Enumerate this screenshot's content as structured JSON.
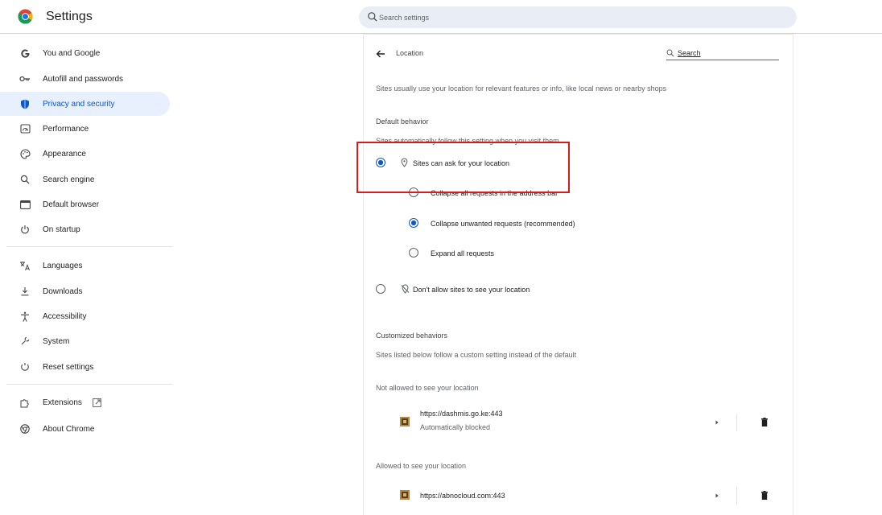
{
  "header": {
    "app_title": "Settings",
    "search_placeholder": "Search settings"
  },
  "sidebar": {
    "items": [
      {
        "label": "You and Google",
        "icon": "google-g-icon"
      },
      {
        "label": "Autofill and passwords",
        "icon": "key-icon"
      },
      {
        "label": "Privacy and security",
        "icon": "shield-icon",
        "active": true
      },
      {
        "label": "Performance",
        "icon": "speedometer-icon"
      },
      {
        "label": "Appearance",
        "icon": "palette-icon"
      },
      {
        "label": "Search engine",
        "icon": "search-icon"
      },
      {
        "label": "Default browser",
        "icon": "browser-window-icon"
      },
      {
        "label": "On startup",
        "icon": "power-icon"
      },
      {
        "label": "Languages",
        "icon": "translate-icon"
      },
      {
        "label": "Downloads",
        "icon": "download-icon"
      },
      {
        "label": "Accessibility",
        "icon": "accessibility-icon"
      },
      {
        "label": "System",
        "icon": "wrench-icon"
      },
      {
        "label": "Reset settings",
        "icon": "reset-icon"
      },
      {
        "label": "Extensions",
        "icon": "puzzle-icon"
      },
      {
        "label": "About Chrome",
        "icon": "chrome-icon"
      }
    ]
  },
  "page": {
    "title": "Location",
    "search_placeholder": "Search",
    "description": "Sites usually use your location for relevant features or info, like local news or nearby shops",
    "default_behavior": {
      "heading": "Default behavior",
      "subheading": "Sites automatically follow this setting when you visit them",
      "options": {
        "ask": "Sites can ask for your location",
        "collapse_all": "Collapse all requests in the address bar",
        "collapse_unwanted": "Collapse unwanted requests (recommended)",
        "expand_all": "Expand all requests",
        "block": "Don't allow sites to see your location"
      }
    },
    "customized": {
      "heading": "Customized behaviors",
      "subheading": "Sites listed below follow a custom setting instead of the default",
      "not_allowed_heading": "Not allowed to see your location",
      "not_allowed_sites": [
        {
          "url": "https://dashmis.go.ke:443",
          "status": "Automatically blocked"
        }
      ],
      "allowed_heading": "Allowed to see your location",
      "allowed_sites": [
        {
          "url": "https://abnocloud.com:443"
        }
      ]
    }
  },
  "colors": {
    "accent": "#0b57d0",
    "active_bg": "#e8f0fe",
    "highlight": "#d81b1b"
  }
}
